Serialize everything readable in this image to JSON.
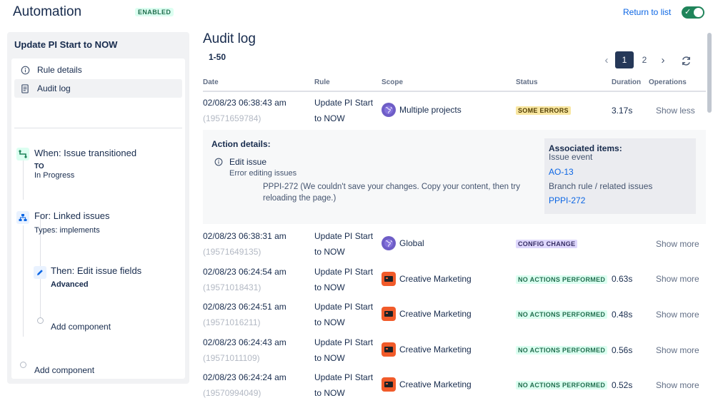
{
  "header": {
    "title": "Automation",
    "enabled_badge": "ENABLED",
    "return_link": "Return to list",
    "toggle_state": "on"
  },
  "sidebar": {
    "rule_name": "Update PI Start to NOW",
    "nav": [
      {
        "label": "Rule details",
        "icon": "info-icon"
      },
      {
        "label": "Audit log",
        "icon": "document-icon",
        "active": true
      }
    ],
    "trigger": {
      "title": "When: Issue transitioned",
      "to_label": "TO",
      "to_value": "In Progress"
    },
    "branch": {
      "title": "For: Linked issues",
      "types": "Types: implements"
    },
    "action": {
      "title": "Then: Edit issue fields",
      "sub": "Advanced"
    },
    "add_component_inner": "Add component",
    "add_component_outer": "Add component"
  },
  "main": {
    "title": "Audit log",
    "range": "1-50",
    "pages": [
      "1",
      "2"
    ],
    "current_page": 1,
    "columns": [
      "Date",
      "Rule",
      "Scope",
      "Status",
      "Duration",
      "Operations"
    ]
  },
  "rows": [
    {
      "date": "02/08/23 06:38:43 am",
      "id": "(19571659784)",
      "rule1": "Update PI Start",
      "rule2": "to NOW",
      "scope": "Multiple projects",
      "scope_icon": "globe-icon",
      "status": "SOME ERRORS",
      "status_kind": "errors",
      "duration": "3.17s",
      "op": "Show less"
    },
    {
      "date": "02/08/23 06:38:31 am",
      "id": "(19571649135)",
      "rule1": "Update PI Start",
      "rule2": "to NOW",
      "scope": "Global",
      "scope_icon": "globe-icon",
      "status": "CONFIG CHANGE",
      "status_kind": "config",
      "duration": "",
      "op": "Show more"
    },
    {
      "date": "02/08/23 06:24:54 am",
      "id": "(19571018431)",
      "rule1": "Update PI Start",
      "rule2": "to NOW",
      "scope": "Creative Marketing",
      "scope_icon": "project-icon",
      "status": "NO ACTIONS PERFORMED",
      "status_kind": "none",
      "duration": "0.63s",
      "op": "Show more"
    },
    {
      "date": "02/08/23 06:24:51 am",
      "id": "(19571016211)",
      "rule1": "Update PI Start",
      "rule2": "to NOW",
      "scope": "Creative Marketing",
      "scope_icon": "project-icon",
      "status": "NO ACTIONS PERFORMED",
      "status_kind": "none",
      "duration": "0.48s",
      "op": "Show more"
    },
    {
      "date": "02/08/23 06:24:43 am",
      "id": "(19571011109)",
      "rule1": "Update PI Start",
      "rule2": "to NOW",
      "scope": "Creative Marketing",
      "scope_icon": "project-icon",
      "status": "NO ACTIONS PERFORMED",
      "status_kind": "none",
      "duration": "0.56s",
      "op": "Show more"
    },
    {
      "date": "02/08/23 06:24:24 am",
      "id": "(19570994049)",
      "rule1": "Update PI Start",
      "rule2": "to NOW",
      "scope": "Creative Marketing",
      "scope_icon": "project-icon",
      "status": "NO ACTIONS PERFORMED",
      "status_kind": "none",
      "duration": "0.52s",
      "op": "Show more"
    }
  ],
  "details": {
    "heading": "Action details:",
    "action_name": "Edit issue",
    "action_error": "Error editing issues",
    "message_line1": "PPPI-272 (We couldn't save your changes. Copy your content, then try",
    "message_line2": "reloading the page.)",
    "assoc_heading": "Associated items:",
    "assoc_event_label": "Issue event",
    "assoc_event_link": "AO-13",
    "assoc_branch_label": "Branch rule / related issues",
    "assoc_branch_link": "PPPI-272"
  },
  "colors": {
    "accent": "#0c66e4",
    "toggle_on": "#1f845a",
    "current_page": "#253858"
  }
}
